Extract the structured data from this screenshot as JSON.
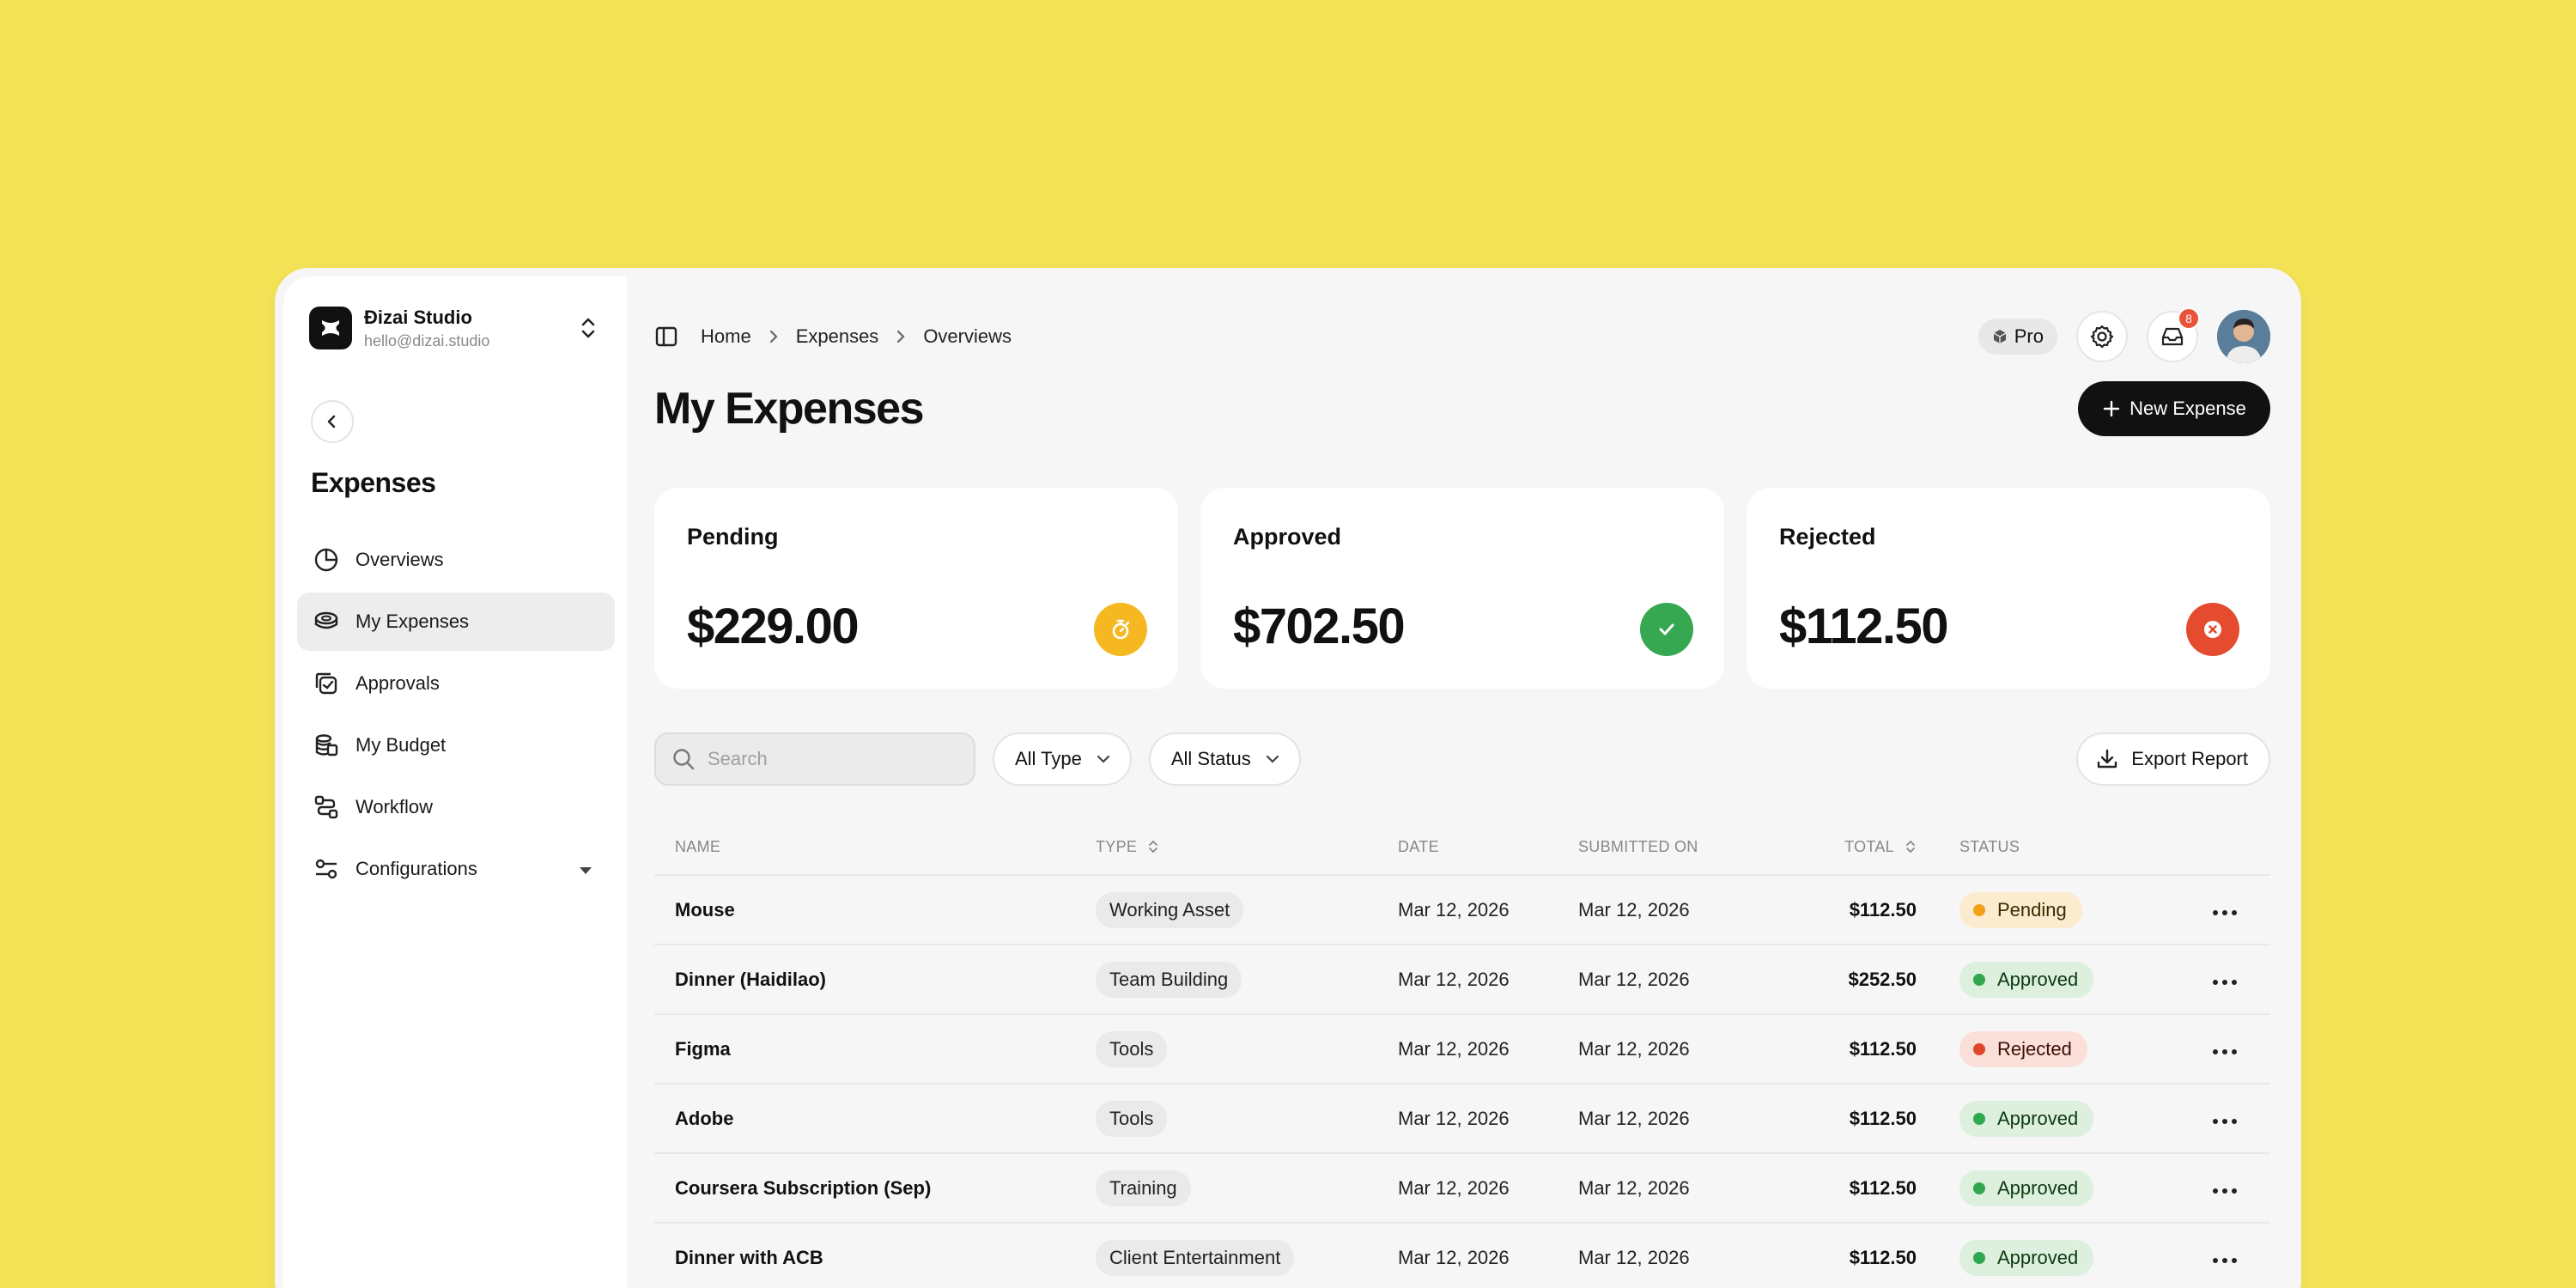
{
  "workspace": {
    "name": "Đizai Studio",
    "email": "hello@dizai.studio"
  },
  "sidebar": {
    "title": "Expenses",
    "items": [
      {
        "label": "Overviews",
        "icon": "pie-chart-icon"
      },
      {
        "label": "My Expenses",
        "icon": "coins-icon",
        "active": true
      },
      {
        "label": "Approvals",
        "icon": "approvals-icon"
      },
      {
        "label": "My Budget",
        "icon": "budget-icon"
      },
      {
        "label": "Workflow",
        "icon": "workflow-icon"
      },
      {
        "label": "Configurations",
        "icon": "config-icon"
      }
    ]
  },
  "breadcrumb": [
    "Home",
    "Expenses",
    "Overviews"
  ],
  "header": {
    "plan": "Pro",
    "notifications": "8"
  },
  "page": {
    "title": "My Expenses",
    "new_button": "New Expense"
  },
  "cards": [
    {
      "label": "Pending",
      "value": "$229.00",
      "color": "#F5B820"
    },
    {
      "label": "Approved",
      "value": "$702.50",
      "color": "#36A852"
    },
    {
      "label": "Rejected",
      "value": "$112.50",
      "color": "#E54B2E"
    }
  ],
  "filters": {
    "search_placeholder": "Search",
    "type": "All Type",
    "status": "All Status",
    "export": "Export Report"
  },
  "table": {
    "columns": [
      "NAME",
      "TYPE",
      "DATE",
      "SUBMITTED ON",
      "TOTAL",
      "STATUS"
    ],
    "rows": [
      {
        "name": "Mouse",
        "type": "Working Asset",
        "date": "Mar 12, 2026",
        "submitted": "Mar 12, 2026",
        "total": "$112.50",
        "status": "Pending"
      },
      {
        "name": "Dinner (Haidilao)",
        "type": "Team Building",
        "date": "Mar 12, 2026",
        "submitted": "Mar 12, 2026",
        "total": "$252.50",
        "status": "Approved"
      },
      {
        "name": "Figma",
        "type": "Tools",
        "date": "Mar 12, 2026",
        "submitted": "Mar 12, 2026",
        "total": "$112.50",
        "status": "Rejected"
      },
      {
        "name": "Adobe",
        "type": "Tools",
        "date": "Mar 12, 2026",
        "submitted": "Mar 12, 2026",
        "total": "$112.50",
        "status": "Approved"
      },
      {
        "name": "Coursera Subscription (Sep)",
        "type": "Training",
        "date": "Mar 12, 2026",
        "submitted": "Mar 12, 2026",
        "total": "$112.50",
        "status": "Approved"
      },
      {
        "name": "Dinner with ACB",
        "type": "Client Entertainment",
        "date": "Mar 12, 2026",
        "submitted": "Mar 12, 2026",
        "total": "$112.50",
        "status": "Approved"
      }
    ]
  },
  "colors": {
    "background": "#F4E357",
    "accent": "#111111",
    "pending": "#F2A216",
    "approved": "#2FA84F",
    "rejected": "#E0452C"
  }
}
